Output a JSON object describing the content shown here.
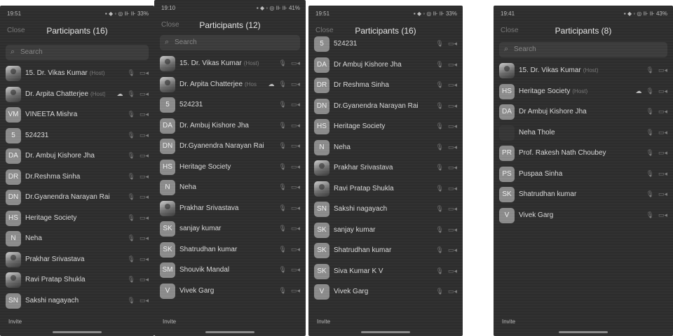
{
  "screens": [
    {
      "time": "19:51",
      "status_icons": "▪ ◆ ◦   ◎ ⊪ ⊪ 33%",
      "close_label": "Close",
      "title": "Participants (16)",
      "search_placeholder": "Search",
      "invite_label": "Invite",
      "participants": [
        {
          "avatar": "",
          "photo": true,
          "name": "15. Dr. Vikas Kumar",
          "tag": "(Host)",
          "cloud": false
        },
        {
          "avatar": "",
          "photo": true,
          "name": "Dr. Arpita Chatterjee",
          "tag": "(Host)",
          "cloud": true
        },
        {
          "avatar": "VM",
          "photo": false,
          "name": "VINEETA Mishra",
          "tag": "",
          "cloud": false
        },
        {
          "avatar": "5",
          "photo": false,
          "name": "524231",
          "tag": "",
          "cloud": false
        },
        {
          "avatar": "DA",
          "photo": false,
          "name": "Dr. Ambuj Kishore Jha",
          "tag": "",
          "cloud": false
        },
        {
          "avatar": "DR",
          "photo": false,
          "name": "Dr.Reshma Sinha",
          "tag": "",
          "cloud": false
        },
        {
          "avatar": "DN",
          "photo": false,
          "name": "Dr.Gyanendra Narayan Rai",
          "tag": "",
          "cloud": false
        },
        {
          "avatar": "HS",
          "photo": false,
          "name": "Heritage Society",
          "tag": "",
          "cloud": false
        },
        {
          "avatar": "N",
          "photo": false,
          "name": "Neha",
          "tag": "",
          "cloud": false
        },
        {
          "avatar": "",
          "photo": true,
          "name": "Prakhar Srivastava",
          "tag": "",
          "cloud": false
        },
        {
          "avatar": "",
          "photo": true,
          "name": "Ravi Pratap Shukla",
          "tag": "",
          "cloud": false
        },
        {
          "avatar": "SN",
          "photo": false,
          "name": "Sakshi nagayach",
          "tag": "",
          "cloud": false
        }
      ]
    },
    {
      "time": "19:10",
      "status_icons": "▪ ◆ ◦   ◎ ⊪ ⊪ 41%",
      "close_label": "Close",
      "title": "Participants (12)",
      "search_placeholder": "Search",
      "invite_label": "Invite",
      "participants": [
        {
          "avatar": "",
          "photo": true,
          "name": "15. Dr. Vikas Kumar",
          "tag": "(Host)",
          "cloud": false
        },
        {
          "avatar": "",
          "photo": true,
          "name": "Dr. Arpita Chatterjee",
          "tag": "(Host)",
          "cloud": true
        },
        {
          "avatar": "5",
          "photo": false,
          "name": "524231",
          "tag": "",
          "cloud": false
        },
        {
          "avatar": "DA",
          "photo": false,
          "name": "Dr. Ambuj Kishore Jha",
          "tag": "",
          "cloud": false
        },
        {
          "avatar": "DN",
          "photo": false,
          "name": "Dr.Gyanendra Narayan Rai",
          "tag": "",
          "cloud": false
        },
        {
          "avatar": "HS",
          "photo": false,
          "name": "Heritage Society",
          "tag": "",
          "cloud": false
        },
        {
          "avatar": "N",
          "photo": false,
          "name": "Neha",
          "tag": "",
          "cloud": false
        },
        {
          "avatar": "",
          "photo": true,
          "name": "Prakhar Srivastava",
          "tag": "",
          "cloud": false
        },
        {
          "avatar": "SK",
          "photo": false,
          "name": "sanjay kumar",
          "tag": "",
          "cloud": false
        },
        {
          "avatar": "SK",
          "photo": false,
          "name": "Shatrudhan kumar",
          "tag": "",
          "cloud": false
        },
        {
          "avatar": "SM",
          "photo": false,
          "name": "Shouvik Mandal",
          "tag": "",
          "cloud": false
        },
        {
          "avatar": "V",
          "photo": false,
          "name": "Vivek Garg",
          "tag": "",
          "cloud": false
        }
      ]
    },
    {
      "time": "19:51",
      "status_icons": "▪ ◆ ◦   ◎ ⊪ ⊪ 33%",
      "close_label": "Close",
      "title": "Participants (16)",
      "search_placeholder": "",
      "invite_label": "Invite",
      "participants": [
        {
          "avatar": "5",
          "photo": false,
          "name": "524231",
          "tag": "",
          "cloud": false
        },
        {
          "avatar": "DA",
          "photo": false,
          "name": "Dr Ambuj Kishore Jha",
          "tag": "",
          "cloud": false
        },
        {
          "avatar": "DR",
          "photo": false,
          "name": "Dr Reshma Sinha",
          "tag": "",
          "cloud": false
        },
        {
          "avatar": "DN",
          "photo": false,
          "name": "Dr.Gyanendra Narayan Rai",
          "tag": "",
          "cloud": false
        },
        {
          "avatar": "HS",
          "photo": false,
          "name": "Heritage Society",
          "tag": "",
          "cloud": false
        },
        {
          "avatar": "N",
          "photo": false,
          "name": "Neha",
          "tag": "",
          "cloud": false
        },
        {
          "avatar": "",
          "photo": true,
          "name": "Prakhar Srivastava",
          "tag": "",
          "cloud": false
        },
        {
          "avatar": "",
          "photo": true,
          "name": "Ravi Pratap Shukla",
          "tag": "",
          "cloud": false
        },
        {
          "avatar": "SN",
          "photo": false,
          "name": "Sakshi nagayach",
          "tag": "",
          "cloud": false
        },
        {
          "avatar": "SK",
          "photo": false,
          "name": "sanjay kumar",
          "tag": "",
          "cloud": false
        },
        {
          "avatar": "SK",
          "photo": false,
          "name": "Shatrudhan kumar",
          "tag": "",
          "cloud": false
        },
        {
          "avatar": "SK",
          "photo": false,
          "name": "Siva Kumar K V",
          "tag": "",
          "cloud": false
        },
        {
          "avatar": "V",
          "photo": false,
          "name": "Vivek Garg",
          "tag": "",
          "cloud": false
        }
      ]
    },
    {
      "time": "19:41",
      "status_icons": "▪ ◆ ◦   ◎ ⊪ ⊪ 43%",
      "close_label": "Close",
      "title": "Participants (8)",
      "search_placeholder": "Search",
      "invite_label": "Invite",
      "participants": [
        {
          "avatar": "",
          "photo": true,
          "name": "15. Dr. Vikas Kumar",
          "tag": "(Host)",
          "cloud": false
        },
        {
          "avatar": "HS",
          "photo": false,
          "name": "Heritage Society",
          "tag": "(Host)",
          "cloud": true
        },
        {
          "avatar": "DA",
          "photo": false,
          "name": "Dr Ambuj Kishore Jha",
          "tag": "",
          "cloud": false
        },
        {
          "avatar": "",
          "photo": false,
          "blank": true,
          "name": "Neha Thole",
          "tag": "",
          "cloud": false
        },
        {
          "avatar": "PR",
          "photo": false,
          "name": "Prof. Rakesh Nath Choubey",
          "tag": "",
          "cloud": false
        },
        {
          "avatar": "PS",
          "photo": false,
          "name": "Puspaa Sinha",
          "tag": "",
          "cloud": false
        },
        {
          "avatar": "SK",
          "photo": false,
          "name": "Shatrudhan kumar",
          "tag": "",
          "cloud": false
        },
        {
          "avatar": "V",
          "photo": false,
          "name": "Vivek Garg",
          "tag": "",
          "cloud": false
        }
      ]
    }
  ],
  "icons": {
    "mic": "🎙",
    "video": "▭◂",
    "cloud": "☁"
  }
}
